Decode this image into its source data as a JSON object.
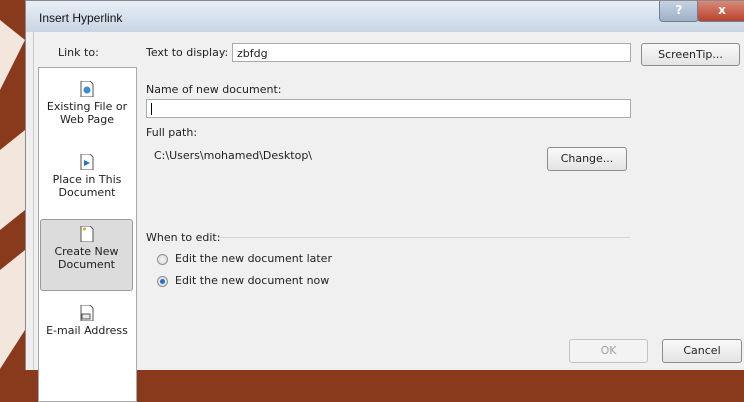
{
  "colors": {
    "backdrop": "#8a3a1c",
    "dialog_bg": "#f0f0f0",
    "accent_radio": "#2a6fc9"
  },
  "dialog": {
    "title": "Insert Hyperlink",
    "help_label": "?",
    "close_label": "x"
  },
  "link_to": {
    "label": "Link to:",
    "items": [
      {
        "label_line1": "Existing File or",
        "label_line2": "Web Page",
        "icon": "web-file-icon",
        "selected": false
      },
      {
        "label_line1": "Place in This",
        "label_line2": "Document",
        "icon": "place-in-document-icon",
        "selected": false
      },
      {
        "label_line1": "Create New",
        "label_line2": "Document",
        "icon": "new-document-icon",
        "selected": true
      },
      {
        "label_line1": "E-mail Address",
        "label_line2": "",
        "icon": "email-icon",
        "selected": false
      }
    ]
  },
  "text_to_display": {
    "label": "Text to display:",
    "value": "zbfdg"
  },
  "screentip_label": "ScreenTip...",
  "new_document": {
    "label": "Name of new document:",
    "value": ""
  },
  "full_path": {
    "label": "Full path:",
    "value": "C:\\Users\\mohamed\\Desktop\\"
  },
  "change_label": "Change...",
  "when_to_edit": {
    "label": "When to edit:",
    "options": [
      {
        "label": "Edit the new document later",
        "checked": false
      },
      {
        "label": "Edit the new document now",
        "checked": true
      }
    ]
  },
  "ok_label": "OK",
  "cancel_label": "Cancel"
}
